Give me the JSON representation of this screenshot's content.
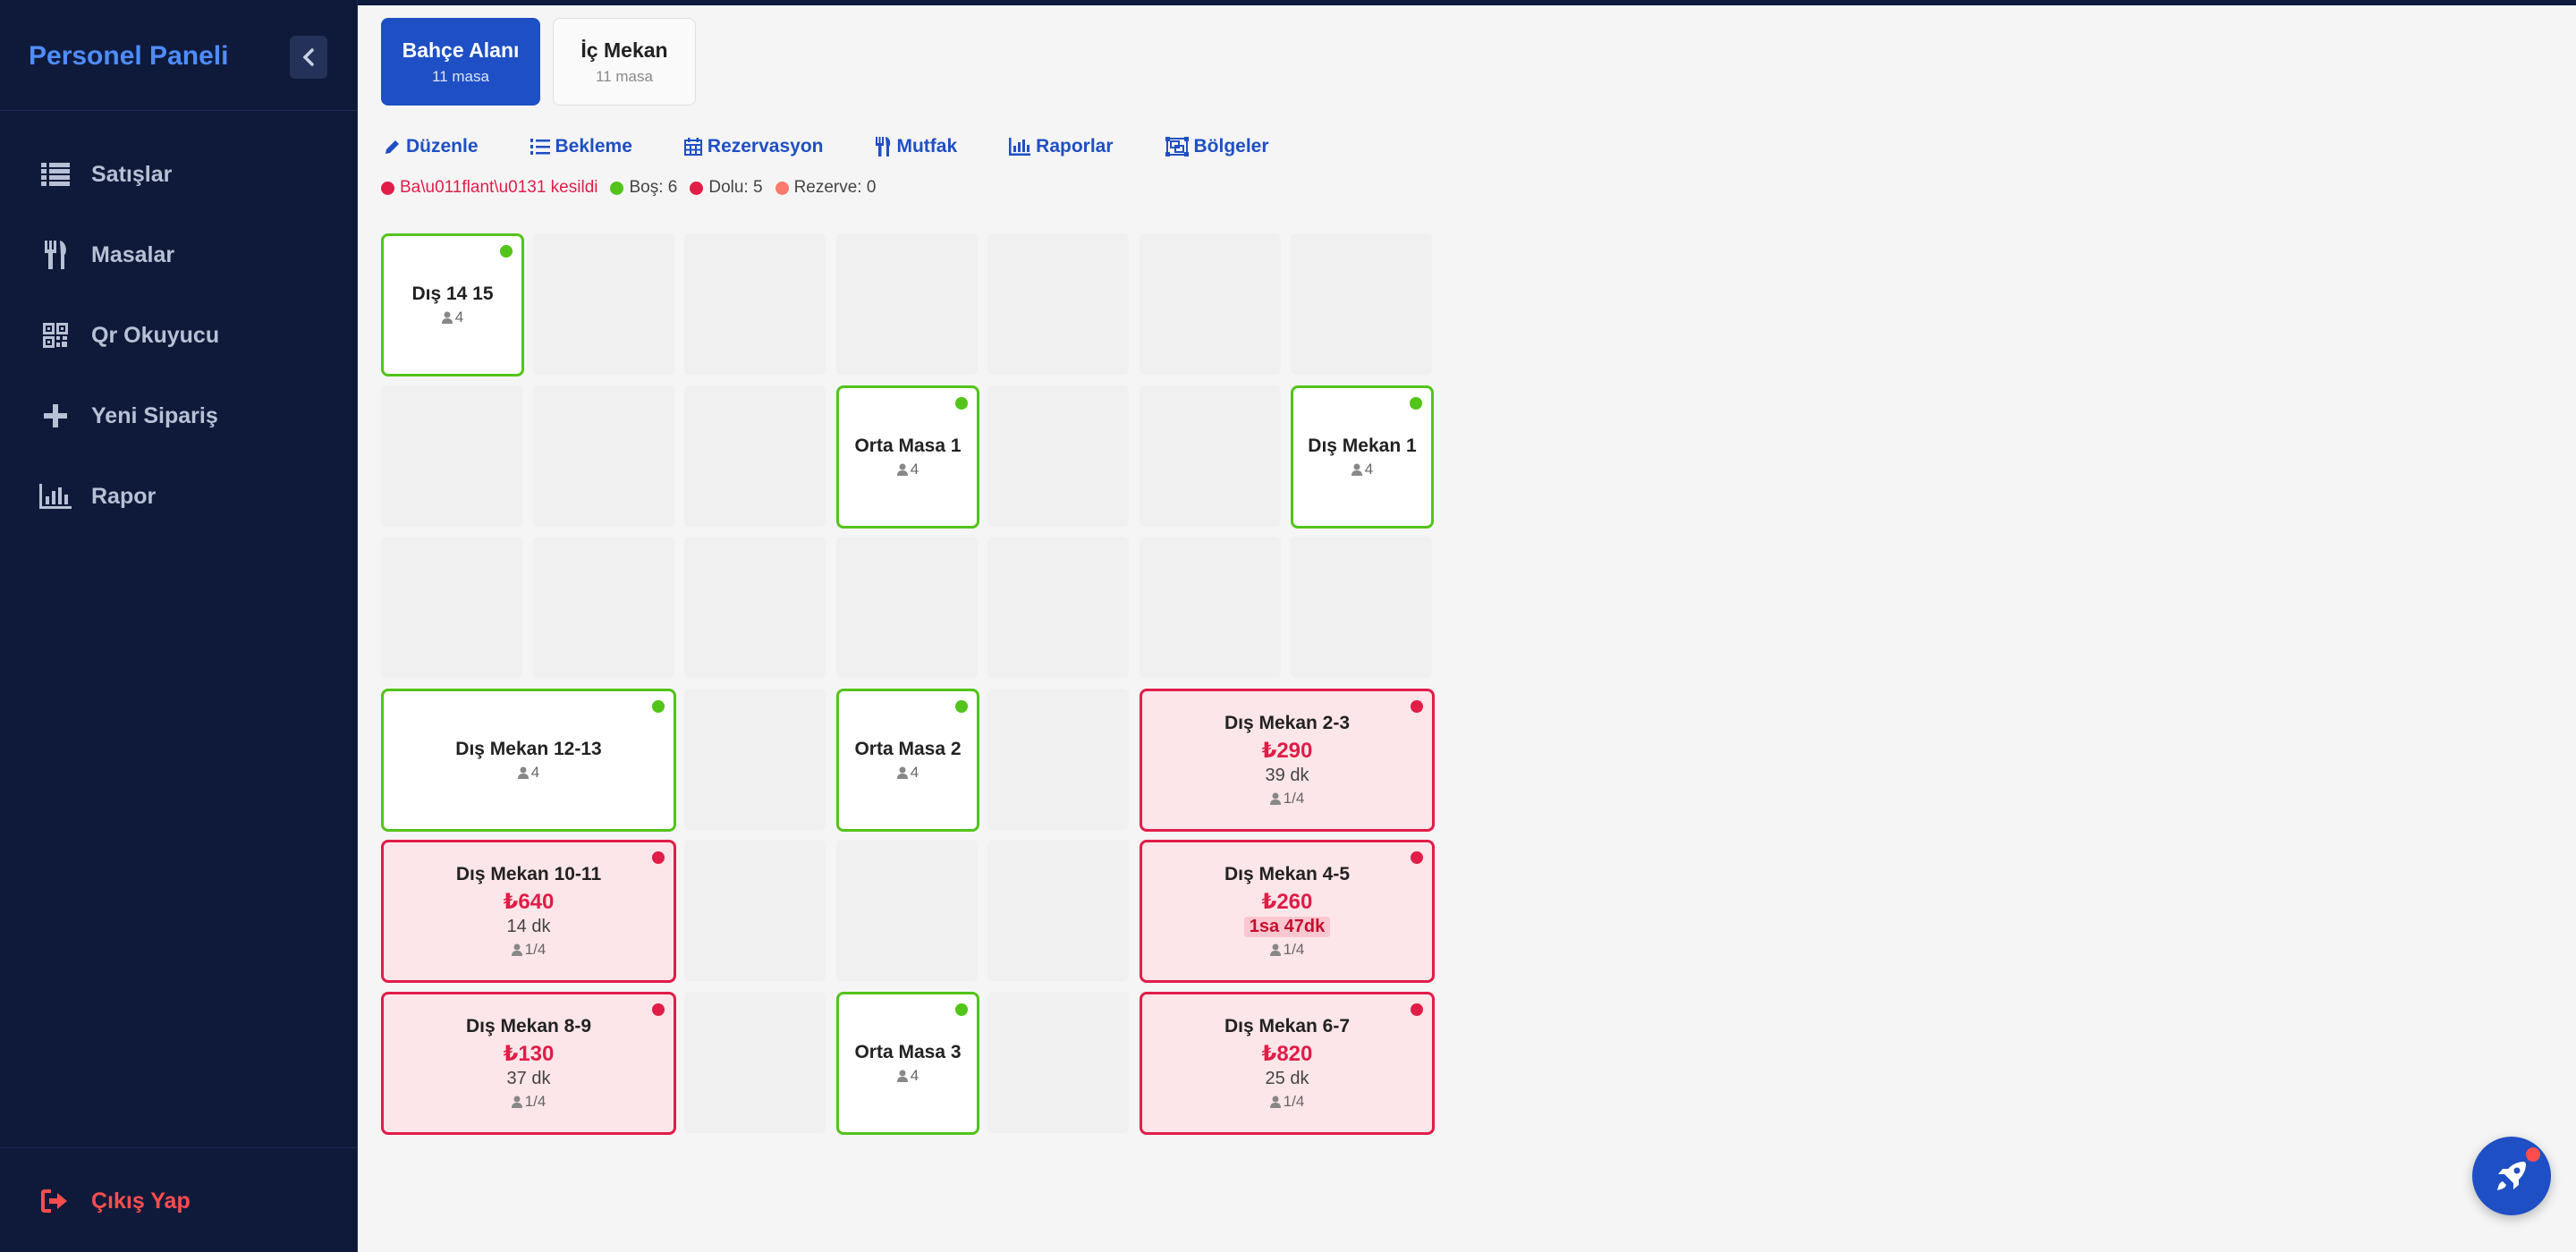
{
  "sidebar": {
    "brand": "Personel Paneli",
    "items": [
      {
        "label": "Satışlar",
        "icon": "list-icon"
      },
      {
        "label": "Masalar",
        "icon": "utensils-icon"
      },
      {
        "label": "Qr Okuyucu",
        "icon": "qrcode-icon"
      },
      {
        "label": "Yeni Sipariş",
        "icon": "plus-icon"
      },
      {
        "label": "Rapor",
        "icon": "chart-bar-icon"
      }
    ],
    "logout": "Çıkış Yap"
  },
  "tabs": [
    {
      "label": "Bahçe Alanı",
      "sub": "11 masa",
      "active": true
    },
    {
      "label": "İç Mekan",
      "sub": "11 masa",
      "active": false
    }
  ],
  "toolbar": {
    "edit": "Düzenle",
    "waiting": "Bekleme",
    "reservation": "Rezervasyon",
    "kitchen": "Mutfak",
    "reports": "Raporlar",
    "regions": "Bölgeler"
  },
  "legend": {
    "connection": "Ba\\u011flant\\u0131 kesildi",
    "free": "Boş: 6",
    "busy": "Dolu: 5",
    "reserved": "Rezerve: 0"
  },
  "tables": {
    "t1": {
      "name": "Dış 14 15",
      "cap": "4"
    },
    "t2": {
      "name": "Orta Masa 1",
      "cap": "4"
    },
    "t3": {
      "name": "Dış Mekan 1",
      "cap": "4"
    },
    "t4": {
      "name": "Dış Mekan 12-13",
      "cap": "4"
    },
    "t5": {
      "name": "Orta Masa 2",
      "cap": "4"
    },
    "t6": {
      "name": "Dış Mekan 2-3",
      "price": "₺290",
      "time": "39 dk",
      "cap": "1/4"
    },
    "t7": {
      "name": "Dış Mekan 10-11",
      "price": "₺640",
      "time": "14 dk",
      "cap": "1/4"
    },
    "t8": {
      "name": "Dış Mekan 4-5",
      "price": "₺260",
      "time": "1sa 47dk",
      "cap": "1/4"
    },
    "t9": {
      "name": "Dış Mekan 8-9",
      "price": "₺130",
      "time": "37 dk",
      "cap": "1/4"
    },
    "t10": {
      "name": "Orta Masa 3",
      "cap": "4"
    },
    "t11": {
      "name": "Dış Mekan 6-7",
      "price": "₺820",
      "time": "25 dk",
      "cap": "1/4"
    }
  },
  "colors": {
    "primary": "#1f4fc4",
    "free": "#52c41a",
    "busy": "#e11d48",
    "reserved": "#ff7a6b",
    "sidebar": "#0f1a3a"
  }
}
